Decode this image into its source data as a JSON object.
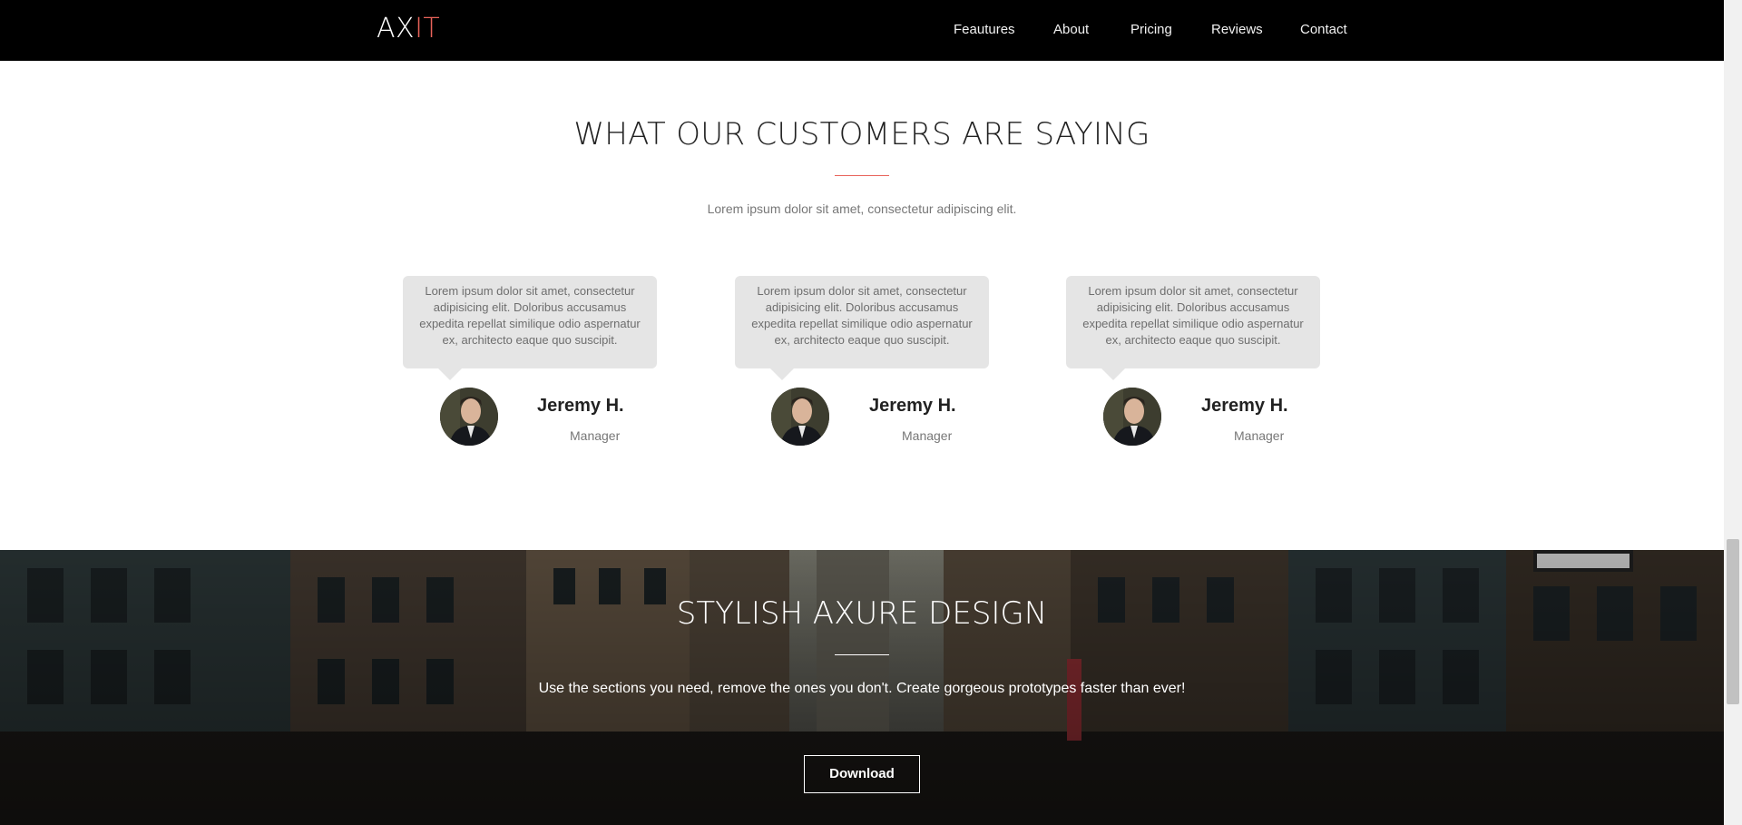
{
  "brand": {
    "logo_main": "AX",
    "logo_accent": "IT",
    "accent_color": "#e8635a"
  },
  "nav": {
    "items": [
      {
        "label": "Feautures"
      },
      {
        "label": "About"
      },
      {
        "label": "Pricing"
      },
      {
        "label": "Reviews"
      },
      {
        "label": "Contact"
      }
    ]
  },
  "testimonials": {
    "title": "WHAT OUR CUSTOMERS ARE SAYING",
    "subtitle": "Lorem ipsum dolor sit amet, consectetur adipiscing elit.",
    "cards": [
      {
        "quote": "Lorem ipsum dolor sit amet, consectetur adipisicing elit. Doloribus accusamus expedita repellat similique odio aspernatur ex, architecto eaque quo suscipit.",
        "name": "Jeremy H.",
        "role": "Manager"
      },
      {
        "quote": "Lorem ipsum dolor sit amet, consectetur adipisicing elit. Doloribus accusamus expedita repellat similique odio aspernatur ex, architecto eaque quo suscipit.",
        "name": "Jeremy H.",
        "role": "Manager"
      },
      {
        "quote": "Lorem ipsum dolor sit amet, consectetur adipisicing elit. Doloribus accusamus expedita repellat similique odio aspernatur ex, architecto eaque quo suscipit.",
        "name": "Jeremy H.",
        "role": "Manager"
      }
    ]
  },
  "cta": {
    "title": "STYLISH AXURE DESIGN",
    "text": "Use the sections you need, remove the ones you don't. Create gorgeous prototypes faster than ever!",
    "button_label": "Download"
  }
}
